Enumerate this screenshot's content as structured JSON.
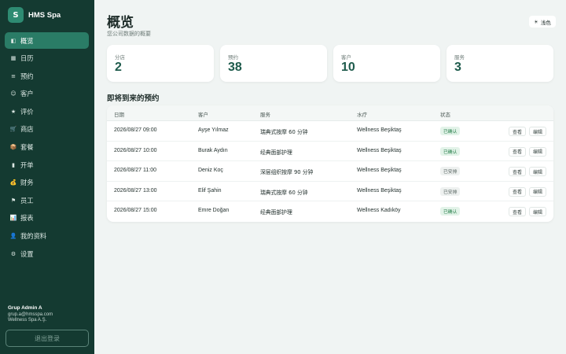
{
  "brand": {
    "logo_letter": "S",
    "name": "HMS Spa"
  },
  "nav": [
    {
      "icon": "layout-icon",
      "glyph": "◧",
      "label": "概览",
      "active": true
    },
    {
      "icon": "calendar-icon",
      "glyph": "▦",
      "label": "日历"
    },
    {
      "icon": "list-icon",
      "glyph": "≡",
      "label": "预约"
    },
    {
      "icon": "customer-icon",
      "glyph": "☺",
      "label": "客户"
    },
    {
      "icon": "star-icon",
      "glyph": "★",
      "label": "评价"
    },
    {
      "icon": "cart-icon",
      "glyph": "🛒",
      "label": "商店"
    },
    {
      "icon": "package-icon",
      "glyph": "📦",
      "label": "套餐"
    },
    {
      "icon": "receipt-icon",
      "glyph": "▮",
      "label": "开单"
    },
    {
      "icon": "money-bag-icon",
      "glyph": "💰",
      "label": "财务"
    },
    {
      "icon": "flag-icon",
      "glyph": "⚑",
      "label": "员工"
    },
    {
      "icon": "chart-icon",
      "glyph": "📊",
      "label": "报表"
    },
    {
      "icon": "profile-icon",
      "glyph": "👤",
      "label": "我的资料"
    },
    {
      "icon": "gear-icon",
      "glyph": "⚙",
      "label": "设置"
    }
  ],
  "user": {
    "name": "Grup Admin A",
    "email": "grup.a@hmsspa.com",
    "company": "Wellness Spa A.Ş."
  },
  "logout_label": "退出登录",
  "header": {
    "title": "概览",
    "subtitle": "您公司数据的概要",
    "theme_icon": "☀",
    "theme_label": "浅色"
  },
  "stats": [
    {
      "label": "分店",
      "value": "2"
    },
    {
      "label": "预约",
      "value": "38"
    },
    {
      "label": "客户",
      "value": "10"
    },
    {
      "label": "服务",
      "value": "3"
    }
  ],
  "upcoming": {
    "title": "即将到来的预约",
    "columns": [
      "日期",
      "客户",
      "服务",
      "水疗",
      "状态"
    ],
    "view_label": "查看",
    "edit_label": "编辑",
    "rows": [
      {
        "date": "2026/08/27 09:00",
        "customer": "Ayşe Yılmaz",
        "service": "瑞典式按摩 60 分钟",
        "spa": "Wellness Beşiktaş",
        "status": "已确认",
        "status_type": "ok"
      },
      {
        "date": "2026/08/27 10:00",
        "customer": "Burak Aydın",
        "service": "经典面部护理",
        "spa": "Wellness Beşiktaş",
        "status": "已确认",
        "status_type": "ok"
      },
      {
        "date": "2026/08/27 11:00",
        "customer": "Deniz Koç",
        "service": "深层组织按摩 90 分钟",
        "spa": "Wellness Beşiktaş",
        "status": "已安排",
        "status_type": "arr"
      },
      {
        "date": "2026/08/27 13:00",
        "customer": "Elif Şahin",
        "service": "瑞典式按摩 60 分钟",
        "spa": "Wellness Beşiktaş",
        "status": "已安排",
        "status_type": "arr"
      },
      {
        "date": "2026/08/27 15:00",
        "customer": "Emre Doğan",
        "service": "经典面部护理",
        "spa": "Wellness Kadıköy",
        "status": "已确认",
        "status_type": "ok"
      }
    ]
  },
  "colors": {
    "sidebar_bg": "#143a31",
    "accent": "#2a7c66",
    "stat_value": "#1e5b4c",
    "badge_ok": "#1e7a43"
  }
}
